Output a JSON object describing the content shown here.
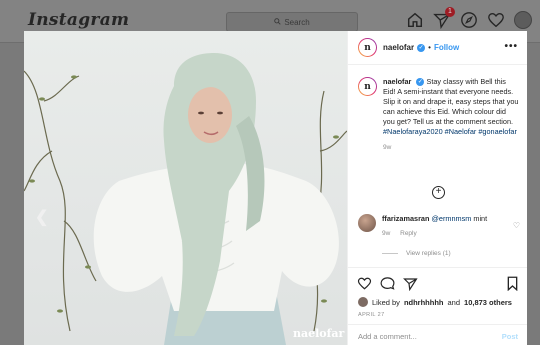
{
  "nav": {
    "logo": "Instagram",
    "search_placeholder": "Search",
    "notification_count": "1"
  },
  "photo": {
    "brand_watermark": "naelofar"
  },
  "post_header": {
    "username": "naelofar",
    "follow_label": "Follow",
    "more_label": "•••"
  },
  "caption": {
    "username": "naelofar",
    "text": "Stay classy with Bell this Eid! A semi-instant that everyone needs. Slip it on and drape it, easy steps that you can achieve this Eid. Which colour did you get? Tell us at the comment section.",
    "hashtags": "#Naelofaraya2020 #Naelofar #gonaelofar",
    "age": "9w"
  },
  "comment": {
    "username": "ffarizamasran",
    "mention": "@ermnmsm",
    "text": "mint",
    "age": "9w",
    "reply_label": "Reply",
    "view_replies": "View replies (1)"
  },
  "likes": {
    "prefix": "Liked by",
    "user": "ndhrhhhhh",
    "middle": "and",
    "count": "10,873 others"
  },
  "date": "APRIL 27",
  "add_comment": {
    "placeholder": "Add a comment...",
    "post_label": "Post"
  },
  "colors": {
    "accent": "#3897f0",
    "hashtag": "#00376b"
  }
}
